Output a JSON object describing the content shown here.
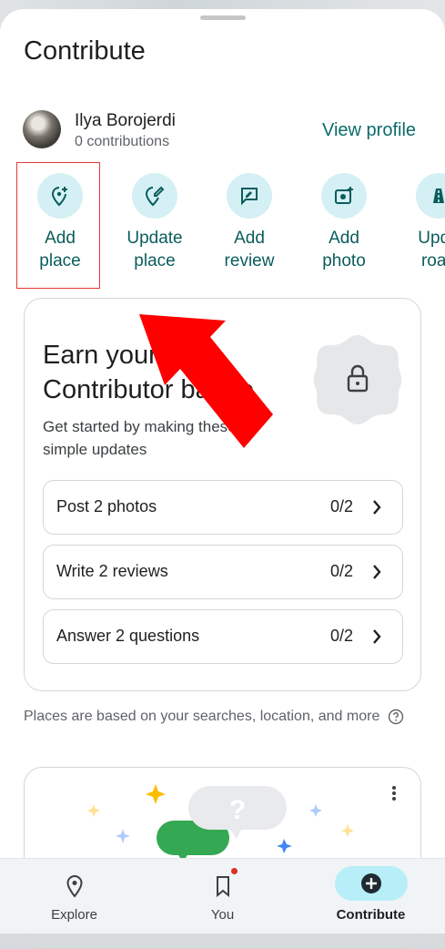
{
  "header": {
    "title": "Contribute"
  },
  "user": {
    "name": "Ilya Borojerdi",
    "contributions": "0 contributions",
    "view_profile": "View profile"
  },
  "actions": [
    {
      "line1": "Add",
      "line2": "place",
      "icon": "add-place-icon"
    },
    {
      "line1": "Update",
      "line2": "place",
      "icon": "edit-place-icon"
    },
    {
      "line1": "Add",
      "line2": "review",
      "icon": "review-icon"
    },
    {
      "line1": "Add",
      "line2": "photo",
      "icon": "add-photo-icon"
    },
    {
      "line1": "Upda",
      "line2": "road",
      "icon": "road-icon"
    }
  ],
  "badge_card": {
    "title_line1": "Earn your new",
    "title_line2": "Contributor badge",
    "description": "Get started by making these simple updates",
    "tasks": [
      {
        "label": "Post 2 photos",
        "progress": "0/2"
      },
      {
        "label": "Write 2 reviews",
        "progress": "0/2"
      },
      {
        "label": "Answer 2 questions",
        "progress": "0/2"
      }
    ]
  },
  "note": {
    "text": "Places are based on your searches, location, and more"
  },
  "bottom_nav": [
    {
      "label": "Explore",
      "icon": "location-pin-icon"
    },
    {
      "label": "You",
      "icon": "bookmark-icon"
    },
    {
      "label": "Contribute",
      "icon": "plus-circle-icon"
    }
  ],
  "colors": {
    "accent": "#0b6b6b",
    "chip_bg": "#d4f0f5",
    "nav_active": "#b7eef7",
    "highlight": "#e53935",
    "arrow": "#ff0000"
  }
}
